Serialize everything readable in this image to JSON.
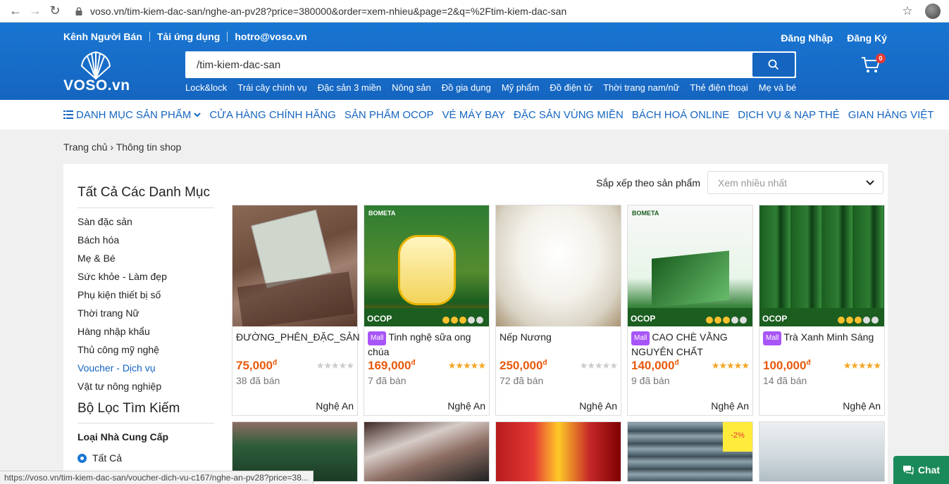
{
  "browser": {
    "url": "voso.vn/tim-kiem-dac-san/nghe-an-pv28?price=380000&order=xem-nhieu&page=2&q=%2Ftim-kiem-dac-san"
  },
  "header": {
    "top_links": [
      "Kênh Người Bán",
      "Tải ứng dụng",
      "hotro@voso.vn"
    ],
    "login": "Đăng Nhập",
    "register": "Đăng Ký",
    "logo_text": "VOSO.vn",
    "search_value": "/tim-kiem-dac-san",
    "cart_count": "0",
    "quick_links": [
      "Lock&lock",
      "Trái cây chính vụ",
      "Đặc sản 3 miền",
      "Nông sản",
      "Đồ gia dụng",
      "Mỹ phẩm",
      "Đồ điện tử",
      "Thời trang nam/nữ",
      "Thẻ điện thoại",
      "Mẹ và bé"
    ]
  },
  "category_nav": [
    "DANH MỤC SẢN PHẨM",
    "CỬA HÀNG CHÍNH HÃNG",
    "SẢN PHẨM OCOP",
    "VÉ MÁY BAY",
    "ĐẶC SẢN VÙNG MIỀN",
    "BÁCH HOÁ ONLINE",
    "DỊCH VỤ & NẠP THẺ",
    "GIAN HÀNG VIỆT"
  ],
  "breadcrumb": {
    "home": "Trang chủ",
    "current": "Thông tin shop"
  },
  "sidebar": {
    "title": "Tất Cả Các Danh Mục",
    "categories": [
      "Sàn đặc sản",
      "Bách hóa",
      "Mẹ & Bé",
      "Sức khỏe - Làm đẹp",
      "Phụ kiện thiết bị số",
      "Thời trang Nữ",
      "Hàng nhập khẩu",
      "Thủ công mỹ nghệ",
      "Voucher - Dịch vụ",
      "Vật tư nông nghiệp"
    ],
    "filter_title": "Bộ Lọc Tìm Kiếm",
    "supplier_label": "Loại Nhà Cung Cấp",
    "supplier_option": "Tất Cả"
  },
  "sort": {
    "label": "Sắp xếp theo sản phẩm",
    "selected": "Xem nhiều nhất"
  },
  "products": [
    {
      "name": "ĐƯỜNG_PHÊN_ĐẶC_SẢN",
      "price": "75,000",
      "sold": "38 đã bán",
      "location": "Nghệ An",
      "mall": false,
      "stars": 0
    },
    {
      "name": "Tinh nghệ sữa ong chúa",
      "price": "169,000",
      "sold": "7 đã bán",
      "location": "Nghệ An",
      "mall": true,
      "stars": 5
    },
    {
      "name": "Nếp Nương",
      "price": "250,000",
      "sold": "72 đã bán",
      "location": "Nghệ An",
      "mall": false,
      "stars": 0
    },
    {
      "name": "CAO CHÈ VẰNG NGUYÊN CHẤT",
      "price": "140,000",
      "sold": "9 đã bán",
      "location": "Nghệ An",
      "mall": true,
      "stars": 5
    },
    {
      "name": "Trà Xanh Minh Sáng",
      "price": "100,000",
      "sold": "14 đã bán",
      "location": "Nghệ An",
      "mall": true,
      "stars": 5
    }
  ],
  "labels": {
    "mall": "Mall",
    "ocop": "OCOP",
    "bometa": "BOMETA",
    "currency": "đ",
    "discount": "-2%"
  },
  "status_url": "https://voso.vn/tim-kiem-dac-san/voucher-dich-vu-c167/nghe-an-pv28?price=38...",
  "chat_label": "Chat",
  "colors": {
    "brand": "#1565c0",
    "price": "#e8590c",
    "star": "#f5a623",
    "chat": "#1b8a5a"
  }
}
